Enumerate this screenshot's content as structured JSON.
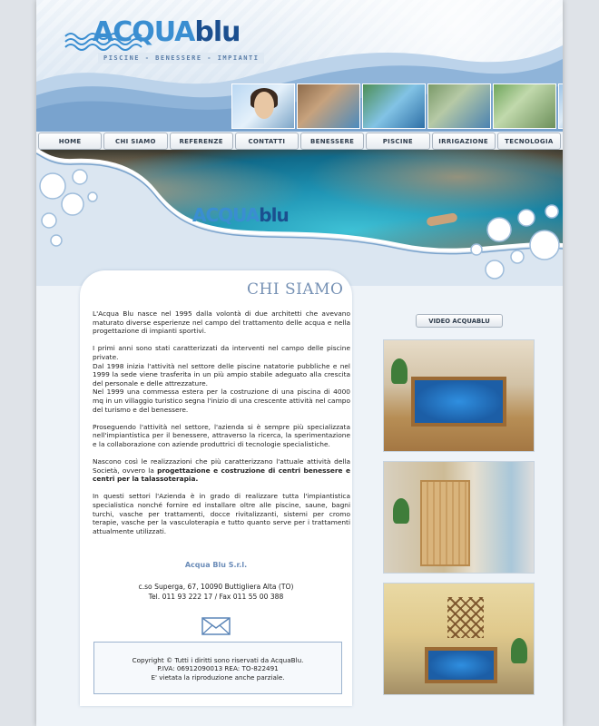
{
  "header": {
    "logo_part1": "ACQUA",
    "logo_part2": "blu",
    "tagline": "PISCINE - BENESSERE - IMPIANTI"
  },
  "nav": {
    "items": [
      {
        "label": "HOME"
      },
      {
        "label": "CHI SIAMO"
      },
      {
        "label": "REFERENZE"
      },
      {
        "label": "CONTATTI"
      },
      {
        "label": "BENESSERE"
      },
      {
        "label": "PISCINE"
      },
      {
        "label": "IRRIGAZIONE"
      },
      {
        "label": "TECNOLOGIA"
      }
    ]
  },
  "banner": {
    "logo_part1": "ACQUA",
    "logo_part2": "blu"
  },
  "main": {
    "title": "CHI SIAMO",
    "paragraphs": [
      "L'Acqua Blu nasce nel 1995 dalla volontà di due architetti che avevano maturato diverse esperienze nel campo del trattamento delle acqua e nella progettazione di impianti sportivi.",
      "I primi anni sono stati caratterizzati da interventi nel campo delle piscine private.",
      "Dal 1998 inizia l'attività nel settore delle piscine natatorie pubbliche e nel 1999 la sede viene trasferita in un più ampio stabile adeguato alla crescita del personale e delle attrezzature.",
      "Nel 1999 una commessa estera per la costruzione di una piscina di 4000 mq in un villaggio turistico segna l'inizio di una crescente attività nel campo del turismo e del benessere.",
      "Proseguendo l'attività nel settore, l'azienda si è sempre più specializzata nell'impiantistica per il benessere, attraverso la ricerca, la sperimentazione e la collaborazione con aziende produttrici di tecnologie specialistiche.",
      "Nascono così le realizzazioni che più caratterizzano l'attuale attività della Società, ovvero la ",
      "progettazione e costruzione di centri benessere e centri per la talassoterapia.",
      "In questi settori l'Azienda è in grado di realizzare tutta l'impiantistica specialistica nonché fornire ed installare oltre alle piscine, saune, bagni turchi, vasche per trattamenti, docce rivitalizzanti, sistemi per cromo terapie, vasche per la vasculoterapia e tutto quanto serve per i trattamenti attualmente utilizzati."
    ],
    "company_name": "Acqua Blu S.r.l.",
    "address_line1": "c.so Superga, 67, 10090 Buttigliera Alta (TO)",
    "address_line2": "Tel. 011 93 222 17 / Fax 011 55 00 388",
    "mail_icon": "envelope-icon",
    "footer_line1": "Copyright © Tutti i diritti sono riservati da AcquaBlu.",
    "footer_line2": "P.IVA: 06912090013 REA: TO-822491",
    "footer_line3": "E' vietata la riproduzione anche parziale."
  },
  "sidebar": {
    "video_button": "VIDEO ACQUABLU"
  },
  "colors": {
    "accent": "#3a8ed1",
    "title": "#7691b4",
    "company": "#6b8cb8"
  }
}
